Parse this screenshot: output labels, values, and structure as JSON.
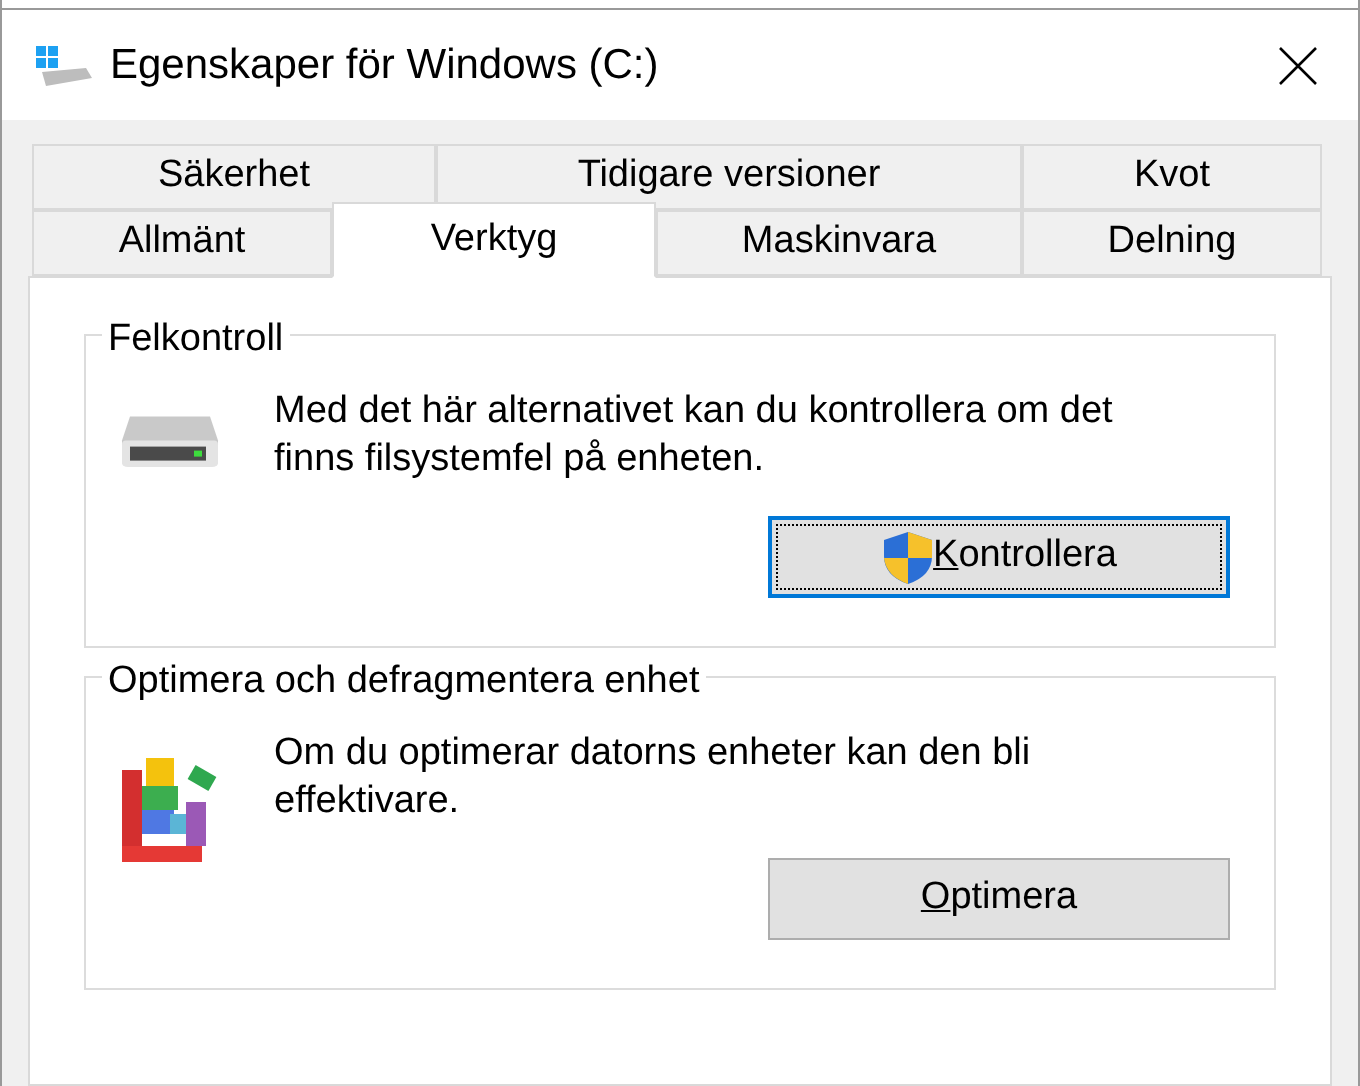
{
  "window": {
    "title": "Egenskaper för Windows (C:)"
  },
  "tab_rows": [
    [
      {
        "label": "Säkerhet",
        "selected": false
      },
      {
        "label": "Tidigare versioner",
        "selected": false
      },
      {
        "label": "Kvot",
        "selected": false
      }
    ],
    [
      {
        "label": "Allmänt",
        "selected": false
      },
      {
        "label": "Verktyg",
        "selected": true
      },
      {
        "label": "Maskinvara",
        "selected": false
      },
      {
        "label": "Delning",
        "selected": false
      }
    ]
  ],
  "groups": [
    {
      "kind": "check",
      "title": "Felkontroll",
      "text": "Med det här alternativet kan du kontrollera om det finns filsystemfel på enheten.",
      "button": {
        "label": "Kontrollera",
        "shield": true,
        "focused": true,
        "mnemonic": true
      }
    },
    {
      "kind": "optimize",
      "title": "Optimera och defragmentera enhet",
      "text": "Om du optimerar datorns enheter kan den bli effektivare.",
      "button": {
        "label": "Optimera",
        "shield": false,
        "focused": false,
        "mnemonic": true
      }
    }
  ]
}
